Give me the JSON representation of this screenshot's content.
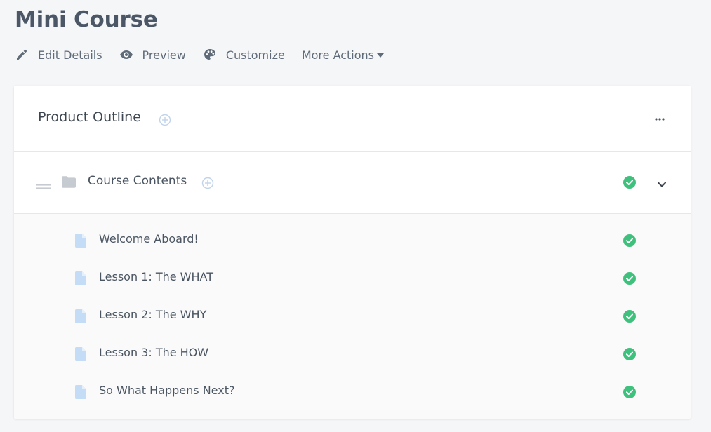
{
  "page": {
    "title": "Mini Course"
  },
  "actions": {
    "edit_label": "Edit Details",
    "preview_label": "Preview",
    "customize_label": "Customize",
    "more_label": "More Actions"
  },
  "outline": {
    "title": "Product Outline",
    "section": {
      "title": "Course Contents",
      "status": "complete"
    },
    "lessons": [
      {
        "title": "Welcome Aboard!",
        "status": "complete"
      },
      {
        "title": "Lesson 1: The WHAT",
        "status": "complete"
      },
      {
        "title": "Lesson 2: The WHY",
        "status": "complete"
      },
      {
        "title": "Lesson 3: The HOW",
        "status": "complete"
      },
      {
        "title": "So What Happens Next?",
        "status": "complete"
      }
    ]
  },
  "icons": {
    "edit": "pencil-icon",
    "preview": "eye-icon",
    "customize": "palette-icon",
    "more": "caret-down-icon",
    "add": "plus-circle-icon",
    "options": "ellipsis-icon",
    "drag": "drag-handle-icon",
    "folder": "folder-icon",
    "lesson": "document-icon",
    "status": "check-circle-icon",
    "collapse": "chevron-down-icon"
  },
  "colors": {
    "success": "#3ec17c",
    "lesson_icon": "#c4dcf6",
    "add_icon": "#c0d3ea",
    "muted_icon": "#c6cbd2"
  }
}
